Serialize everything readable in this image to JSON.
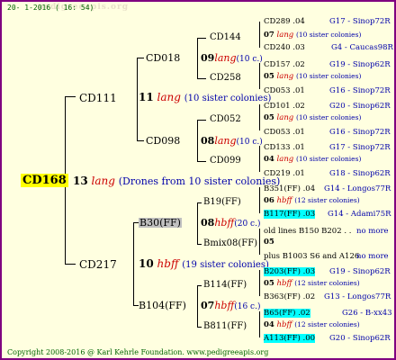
{
  "header": {
    "date": "20- 1-2016 ( 16: 54)",
    "watermark": "pedigreeapis.org"
  },
  "footer": "Copyright 2008-2016 @ Karl Kehrle Foundation.  www.pedigreeapis.org",
  "root": {
    "id": "CD168",
    "num": "13",
    "race": "lang",
    "note": "(Drones from 10 sister colonies)"
  },
  "gen1": [
    {
      "id": "CD111",
      "num": "11",
      "race": "lang",
      "note": "(10 sister colonies)"
    },
    {
      "id": "CD217",
      "num": "10",
      "race": "hbff",
      "note": "(19 sister colonies)"
    }
  ],
  "gen2": [
    {
      "id": "CD018",
      "num": "09",
      "race": "lang",
      "note": "(10 c.)"
    },
    {
      "id": "CD098",
      "num": "08",
      "race": "lang",
      "note": "(10 c.)"
    },
    {
      "id": "B30(FF)",
      "num": "08",
      "race": "hbff",
      "note": "(20 c.)"
    },
    {
      "id": "B104(FF)",
      "num": "07",
      "race": "hbff",
      "note": "(16 c.)"
    }
  ],
  "gen3": [
    {
      "id": "CD144",
      "num": "07",
      "race": "lang",
      "note": "(10 sister colonies)"
    },
    {
      "id": "CD258",
      "num": "05",
      "race": "lang",
      "note": "(10 sister colonies)"
    },
    {
      "id": "CD052",
      "num": "05",
      "race": "lang",
      "note": "(10 sister colonies)"
    },
    {
      "id": "CD099",
      "num": "04",
      "race": "lang",
      "note": "(10 sister colonies)"
    },
    {
      "id": "B19(FF)",
      "num": "06",
      "race": "hbff",
      "note": "(12 sister colonies)"
    },
    {
      "id": "Bmix08(FF)",
      "num": "05",
      "race": "",
      "note": ""
    },
    {
      "id": "B114(FF)",
      "num": "05",
      "race": "hbff",
      "note": "(12 sister colonies)"
    },
    {
      "id": "B811(FF)",
      "num": "04",
      "race": "hbff",
      "note": "(12 sister colonies)"
    }
  ],
  "gen4": [
    {
      "a": "CD289 .04",
      "b": "G17 - Sinop72R"
    },
    {
      "a": "CD240 .03",
      "b": "G4 - Caucas98R"
    },
    {
      "a": "CD157 .02",
      "b": "G19 - Sinop62R"
    },
    {
      "a": "CD053 .01",
      "b": "G16 - Sinop72R"
    },
    {
      "a": "CD101 .02",
      "b": "G20 - Sinop62R"
    },
    {
      "a": "CD053 .01",
      "b": "G16 - Sinop72R"
    },
    {
      "a": "CD133 .01",
      "b": "G17 - Sinop72R"
    },
    {
      "a": "CD219 .01",
      "b": "G18 - Sinop62R"
    },
    {
      "a": "B351(FF) .04",
      "b": "G14 - Longos77R"
    },
    {
      "a": "B117(FF) .03",
      "b": "G14 - Adami75R"
    },
    {
      "a": "old lines B150 B202 . .",
      "b": "no more"
    },
    {
      "a": "plus B1003 S6 and A126",
      "b": "no more"
    },
    {
      "a": "B203(FF) .03",
      "b": "G19 - Sinop62R"
    },
    {
      "a": "B363(FF) .02",
      "b": "G13 - Longos77R"
    },
    {
      "a": "B65(FF) .02",
      "b": "G26 - B-xx43"
    },
    {
      "a": "A113(FF) .00",
      "b": "G20 - Sinop62R"
    }
  ]
}
